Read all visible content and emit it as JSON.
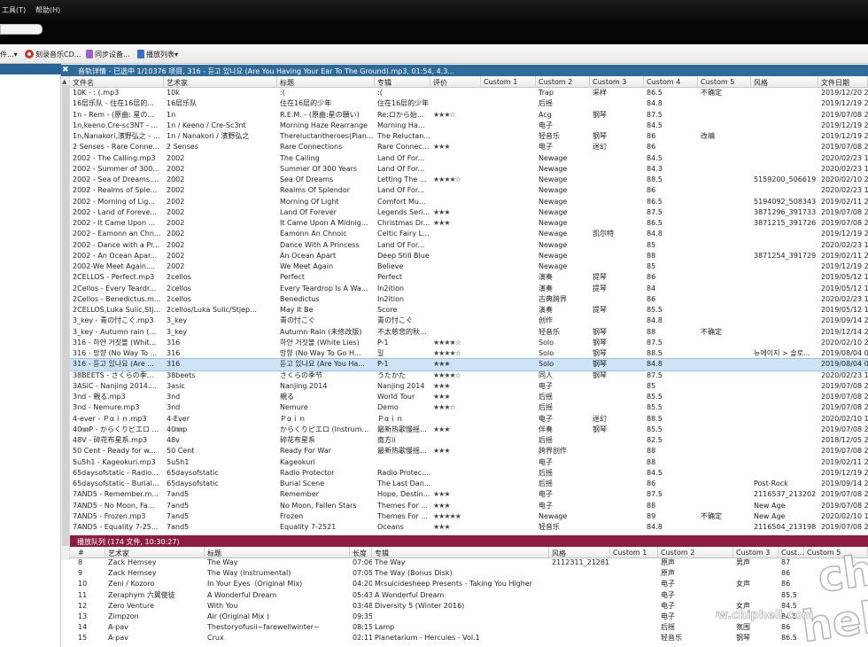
{
  "menu": {
    "tools": "工具(T)",
    "help": "帮助(H)"
  },
  "toolbar": {
    "items": [
      {
        "label": "件..."
      },
      {
        "label": "刻录音乐CD..."
      },
      {
        "label": "同步设备..."
      },
      {
        "label": "播放列表"
      }
    ],
    "dropdown_arrow": "▾",
    "colors": {
      "burn": "#c0392b",
      "sync": "#a061c2",
      "playlist": "#3a6fc4"
    }
  },
  "track_panel": {
    "close_glyph": "✖",
    "title": "音轨详情 - 已选中 1/10376 项目, 316 - 듣고 있나요 (Are You Having Your Ear To The Ground).mp3, 01:54, 4.3..."
  },
  "columns": [
    "文件名",
    "艺术家",
    "标题",
    "专辑",
    "评价",
    "Custom 1",
    "Custom 2",
    "Custom 3",
    "Custom 4",
    "Custom 5",
    "风格",
    "文件日期"
  ],
  "sort_glyph": "▲",
  "rows": [
    {
      "file": "10K - : (.mp3",
      "artist": "10k",
      "title": ":(",
      "album": ":(",
      "rating": "",
      "c1": "",
      "c2": "Trap",
      "c3": "采样",
      "c4": "86.5",
      "c5": "不确定",
      "genre": "",
      "date": "2019/12/20 2",
      "sel": false
    },
    {
      "file": "16层乐队 - 住在16层的...",
      "artist": "16层乐队",
      "title": "住在16层的少年",
      "album": "住在16层的少年",
      "rating": "",
      "c1": "",
      "c2": "后摇",
      "c3": "",
      "c4": "84.8",
      "c5": "",
      "genre": "",
      "date": "2019/12/19 2",
      "sel": false
    },
    {
      "file": "1n - Rem - (原曲: 星の...",
      "artist": "1n",
      "title": "R.E.M. - (原曲:星の願い)",
      "album": "Re:ロから始...",
      "rating": "★★★☆",
      "c1": "",
      "c2": "Acg",
      "c3": "钢琴",
      "c4": "87.5",
      "c5": "",
      "genre": "",
      "date": "2019/07/08 2",
      "sel": false
    },
    {
      "file": "1n,keeno,Cre-sc3NT - ...",
      "artist": "1n / Keeno / Cre-Sc3nt",
      "title": "Morning Haze Rearrange",
      "album": "Morning Ha...",
      "rating": "",
      "c1": "",
      "c2": "电子",
      "c3": "",
      "c4": "84.5",
      "c5": "",
      "genre": "",
      "date": "2019/12/19 2",
      "sel": false
    },
    {
      "file": "1n,Nanakori,濱野弘之 - ...",
      "artist": "1n / Nanakori / 濱野弘之",
      "title": "Thereluctantheroes(Pian...",
      "album": "The Reluctan...",
      "rating": "",
      "c1": "",
      "c2": "轻音乐",
      "c3": "钢琴",
      "c4": "86",
      "c5": "改编",
      "genre": "",
      "date": "2019/12/19 2",
      "sel": false
    },
    {
      "file": "2 Senses - Rare Conne...",
      "artist": "2 Senses",
      "title": "Rare Connections",
      "album": "Rare Connec...",
      "rating": "★★★",
      "c1": "",
      "c2": "电子",
      "c3": "迷幻",
      "c4": "86",
      "c5": "",
      "genre": "",
      "date": "2019/07/08 2",
      "sel": false
    },
    {
      "file": "2002 - The Calling.mp3",
      "artist": "2002",
      "title": "The Calling",
      "album": "Land Of For...",
      "rating": "",
      "c1": "",
      "c2": "Newage",
      "c3": "",
      "c4": "84.5",
      "c5": "",
      "genre": "",
      "date": "2020/02/23 1",
      "sel": false
    },
    {
      "file": "2002 - Summer of 300...",
      "artist": "2002",
      "title": "Summer Of 300 Years",
      "album": "Land Of For...",
      "rating": "",
      "c1": "",
      "c2": "Newage",
      "c3": "",
      "c4": "84.3",
      "c5": "",
      "genre": "",
      "date": "2020/02/23 1",
      "sel": false
    },
    {
      "file": "2002 - Sea of Dreams....",
      "artist": "2002",
      "title": "Sea Of Dreams",
      "album": "Letting The ...",
      "rating": "★★★★☆",
      "c1": "",
      "c2": "Newage",
      "c3": "",
      "c4": "88.5",
      "c5": "",
      "genre": "5159200_506619",
      "date": "2020/02/10 2",
      "sel": false
    },
    {
      "file": "2002 - Realms of Sple...",
      "artist": "2002",
      "title": "Realms Of Splendor",
      "album": "Land Of For...",
      "rating": "",
      "c1": "",
      "c2": "Newage",
      "c3": "",
      "c4": "86",
      "c5": "",
      "genre": "",
      "date": "2020/02/23 1",
      "sel": false
    },
    {
      "file": "2002 - Morning of Lig...",
      "artist": "2002",
      "title": "Morning Of Light",
      "album": "Comfort Mu...",
      "rating": "",
      "c1": "",
      "c2": "Newage",
      "c3": "",
      "c4": "86.5",
      "c5": "",
      "genre": "5194092_508343",
      "date": "2019/02/11 2",
      "sel": false
    },
    {
      "file": "2002 - Land of Foreve...",
      "artist": "2002",
      "title": "Land Of Forever",
      "album": "Legends Seri...",
      "rating": "★★★",
      "c1": "",
      "c2": "Newage",
      "c3": "",
      "c4": "87.5",
      "c5": "",
      "genre": "3871296_391733",
      "date": "2019/07/08 2",
      "sel": false
    },
    {
      "file": "2002 - It Came Upon ...",
      "artist": "2002",
      "title": "It Came Upon A Midnig...",
      "album": "Christmas Dr...",
      "rating": "★★★",
      "c1": "",
      "c2": "Newage",
      "c3": "",
      "c4": "86.5",
      "c5": "",
      "genre": "3871215_391726",
      "date": "2019/07/08 2",
      "sel": false
    },
    {
      "file": "2002 - Eamonn an Chn...",
      "artist": "2002",
      "title": "Éamonn An Chnoic",
      "album": "Celtic Fairy L...",
      "rating": "",
      "c1": "",
      "c2": "Newage",
      "c3": "凯尔特",
      "c4": "84.8",
      "c5": "",
      "genre": "",
      "date": "2019/12/19 2",
      "sel": false
    },
    {
      "file": "2002 - Dance with a Pr...",
      "artist": "2002",
      "title": "Dance With A Princess",
      "album": "Land Of For...",
      "rating": "",
      "c1": "",
      "c2": "Newage",
      "c3": "",
      "c4": "85",
      "c5": "",
      "genre": "",
      "date": "2020/02/23 1",
      "sel": false
    },
    {
      "file": "2002 - An Ocean Apar...",
      "artist": "2002",
      "title": "An Ocean Apart",
      "album": "Deep Still Blue",
      "rating": "",
      "c1": "",
      "c2": "Newage",
      "c3": "",
      "c4": "88",
      "c5": "",
      "genre": "3871254_391729",
      "date": "2019/02/11 2",
      "sel": false
    },
    {
      "file": "2002-We Meet Again....",
      "artist": "2002",
      "title": "We Meet Again",
      "album": "Believe",
      "rating": "",
      "c1": "",
      "c2": "Newage",
      "c3": "",
      "c4": "85",
      "c5": "",
      "genre": "",
      "date": "2019/12/19 2",
      "sel": false
    },
    {
      "file": "2CELLOS - Perfect.mp3",
      "artist": "2cellos",
      "title": "Perfect",
      "album": "Perfect",
      "rating": "",
      "c1": "",
      "c2": "演奏",
      "c3": "提琴",
      "c4": "86",
      "c5": "",
      "genre": "",
      "date": "2019/05/12 1",
      "sel": false
    },
    {
      "file": "2Cellos - Every Teardr...",
      "artist": "2cellos",
      "title": "Every Teardrop Is A Wa...",
      "album": "In2ition",
      "rating": "",
      "c1": "",
      "c2": "演奏",
      "c3": "提琴",
      "c4": "84",
      "c5": "",
      "genre": "",
      "date": "2019/05/12 1",
      "sel": false
    },
    {
      "file": "2Cellos - Benedictus.m...",
      "artist": "2cellos",
      "title": "Benedictus",
      "album": "In2ition",
      "rating": "",
      "c1": "",
      "c2": "古典跨界",
      "c3": "",
      "c4": "86",
      "c5": "",
      "genre": "",
      "date": "2020/02/23 1",
      "sel": false
    },
    {
      "file": "2CELLOS,Luka Sulic,Stj...",
      "artist": "2cellos/Luka Sulic/Stjep...",
      "title": "May It Be",
      "album": "Score",
      "rating": "",
      "c1": "",
      "c2": "演奏",
      "c3": "提琴",
      "c4": "85.5",
      "c5": "",
      "genre": "",
      "date": "2019/05/12 1",
      "sel": false
    },
    {
      "file": "3_key - 青の忖こぐ.mp3",
      "artist": "3_key",
      "title": "青の忖こぐ",
      "album": "青の忖こぐ",
      "rating": "",
      "c1": "",
      "c2": "创作",
      "c3": "",
      "c4": "84.8",
      "c5": "",
      "genre": "",
      "date": "2019/09/14 2",
      "sel": false
    },
    {
      "file": "3_key - Autumn rain (...",
      "artist": "3_key",
      "title": "Autumn Rain (未修改版)",
      "album": "不太慈悲的秋...",
      "rating": "",
      "c1": "",
      "c2": "轻音乐",
      "c3": "钢琴",
      "c4": "88",
      "c5": "不确定",
      "genre": "",
      "date": "2019/12/14 2",
      "sel": false
    },
    {
      "file": "316 - 하얀 거짓볼 (Whit...",
      "artist": "316",
      "title": "하얀 거짓볼 (White Lies)",
      "album": "P-1",
      "rating": "★★★★☆",
      "c1": "",
      "c2": "Solo",
      "c3": "钢琴",
      "c4": "87.5",
      "c5": "",
      "genre": "",
      "date": "2020/02/10 2",
      "sel": false
    },
    {
      "file": "316 - 망향 (No Way To ...",
      "artist": "316",
      "title": "망향 (No Way To Go H...",
      "album": "밀",
      "rating": "★★★★☆",
      "c1": "",
      "c2": "Solo",
      "c3": "钢琴",
      "c4": "88.5",
      "c5": "",
      "genre": "뉴에이지 > 솔로...",
      "date": "2019/08/04 0",
      "sel": false
    },
    {
      "file": "316 - 듣고 있나요 (Are ...",
      "artist": "316",
      "title": "듣고 있나요 (Are You Ha...",
      "album": "P-1",
      "rating": "★★★",
      "c1": "",
      "c2": "Solo",
      "c3": "钢琴",
      "c4": "84.8",
      "c5": "",
      "genre": "",
      "date": "2019/08/04 0",
      "sel": true
    },
    {
      "file": "38BEETS - さくらの季...",
      "artist": "38beets",
      "title": "さくらの季节",
      "album": "うたかた",
      "rating": "★★★★☆",
      "c1": "",
      "c2": "同人",
      "c3": "钢琴",
      "c4": "87.5",
      "c5": "",
      "genre": "",
      "date": "2020/02/23 1",
      "sel": false
    },
    {
      "file": "3ASiC - Nanjing 2014....",
      "artist": "3asic",
      "title": "Nanjing 2014",
      "album": "Nanjing 2014",
      "rating": "★★★",
      "c1": "",
      "c2": "电子",
      "c3": "",
      "c4": "85",
      "c5": "",
      "genre": "",
      "date": "2019/07/08 2",
      "sel": false
    },
    {
      "file": "3nd - 親る.mp3",
      "artist": "3nd",
      "title": "親る",
      "album": "World Tour",
      "rating": "★★★",
      "c1": "",
      "c2": "后摇",
      "c3": "",
      "c4": "85.5",
      "c5": "",
      "genre": "",
      "date": "2019/07/08 2",
      "sel": false
    },
    {
      "file": "3nd - Nemure.mp3",
      "artist": "3nd",
      "title": "Nemure",
      "album": "Demo",
      "rating": "★★★☆",
      "c1": "",
      "c2": "后摇",
      "c3": "",
      "c4": "85.5",
      "c5": "",
      "genre": "",
      "date": "2019/07/08 2",
      "sel": false
    },
    {
      "file": "4-ever - Ｐαｉｎ.mp3",
      "artist": "4-Ever",
      "title": "Ｐαｉｎ",
      "album": "Ｐαｉｎ",
      "rating": "",
      "c1": "",
      "c2": "电子",
      "c3": "迷幻",
      "c4": "88.5",
      "c5": "",
      "genre": "",
      "date": "2020/02/10 1",
      "sel": false
    },
    {
      "file": "40㎜P - からくりピエロ ...",
      "artist": "40㎜p",
      "title": "からくりピエロ (Instrum...",
      "album": "最新热歌慢摇...",
      "rating": "★★★",
      "c1": "",
      "c2": "伴奏",
      "c3": "钢琴",
      "c4": "85.5",
      "c5": "",
      "genre": "",
      "date": "2019/07/08 2",
      "sel": false
    },
    {
      "file": "48V - 碎花布星系.mp3",
      "artist": "48v",
      "title": "碎花布星系",
      "album": "南方ii",
      "rating": "",
      "c1": "",
      "c2": "后摇",
      "c3": "",
      "c4": "82.5",
      "c5": "",
      "genre": "",
      "date": "2018/12/05 2",
      "sel": false
    },
    {
      "file": "50 Cent - Ready for w...",
      "artist": "50 Cent",
      "title": "Ready For War",
      "album": "最新热歌慢摇...",
      "rating": "★★★",
      "c1": "",
      "c2": "跨界创作",
      "c3": "",
      "c4": "88",
      "c5": "",
      "genre": "",
      "date": "2019/07/08 2",
      "sel": false
    },
    {
      "file": "5u5h1 - Kageokuri.mp3",
      "artist": "5u5h1",
      "title": "Kageokuri",
      "album": "",
      "rating": "",
      "c1": "",
      "c2": "电子",
      "c3": "",
      "c4": "88",
      "c5": "",
      "genre": "",
      "date": "2019/02/11 2",
      "sel": false
    },
    {
      "file": "65daysofstatic - Radio...",
      "artist": "65daysofstatic",
      "title": "Radio Protector",
      "album": "Radio Protec...",
      "rating": "",
      "c1": "",
      "c2": "后摇",
      "c3": "",
      "c4": "84.5",
      "c5": "",
      "genre": "",
      "date": "2019/12/19 2",
      "sel": false
    },
    {
      "file": "65daysofstatic - Burial...",
      "artist": "65daysofstatic",
      "title": "Burial Scene",
      "album": "The Last Dan...",
      "rating": "",
      "c1": "",
      "c2": "后摇",
      "c3": "",
      "c4": "86",
      "c5": "",
      "genre": "Post-Rock",
      "date": "2019/09/14 2",
      "sel": false
    },
    {
      "file": "7AND5 - Remember.m...",
      "artist": "7and5",
      "title": "Remember",
      "album": "Hope, Destin...",
      "rating": "★★★",
      "c1": "",
      "c2": "电子",
      "c3": "",
      "c4": "87.5",
      "c5": "",
      "genre": "2116537_213202",
      "date": "2019/07/08 2",
      "sel": false
    },
    {
      "file": "7AND5 - No Moon, Fa...",
      "artist": "7and5",
      "title": "No Moon, Fallen Stars",
      "album": "Themes For ...",
      "rating": "★★★",
      "c1": "",
      "c2": "电子",
      "c3": "",
      "c4": "88",
      "c5": "",
      "genre": "New Age",
      "date": "2019/07/08 2",
      "sel": false
    },
    {
      "file": "7AND5 - Frozen.mp3",
      "artist": "7and5",
      "title": "Frozen",
      "album": "Themes For ...",
      "rating": "★★★★★",
      "c1": "",
      "c2": "Newage",
      "c3": "",
      "c4": "89",
      "c5": "不确定",
      "genre": "New Age",
      "date": "2020/02/10 1",
      "sel": false
    },
    {
      "file": "7AND5 - Equality 7-25...",
      "artist": "7and5",
      "title": "Equality 7-2521",
      "album": "Oceans",
      "rating": "★★★",
      "c1": "",
      "c2": "轻音乐",
      "c3": "",
      "c4": "84.8",
      "c5": "",
      "genre": "2116504_213198",
      "date": "2019/07/08 2",
      "sel": false
    }
  ],
  "queue": {
    "title": "播放队列 (174 文件, 10:30:27)",
    "columns": [
      "#",
      "艺术家",
      "标题",
      "长度",
      "专辑",
      "风格",
      "Custom 1",
      "Custom 2",
      "Custom 3",
      "Cust...",
      "Custom 5"
    ],
    "rows": [
      {
        "n": "8",
        "artist": "Zack Hemsey",
        "title": "The Way",
        "len": "07:06",
        "album": "The Way",
        "genre": "2112311_212812",
        "c1": "",
        "c2": "原声",
        "c3": "男声",
        "c4": "87"
      },
      {
        "n": "9",
        "artist": "Zack Hemsey",
        "title": "The Way (Instrumental)",
        "len": "07:05",
        "album": "The Way (Bonus Disk)",
        "genre": "",
        "c1": "",
        "c2": "原声",
        "c3": "",
        "c4": "86"
      },
      {
        "n": "10",
        "artist": "Zeni / Kozoro",
        "title": "In Your Eyes（Original Mix)",
        "len": "04:20",
        "album": "Mrsuicidesheep Presents - Taking You Higher",
        "genre": "",
        "c1": "",
        "c2": "电子",
        "c3": "女声",
        "c4": "86"
      },
      {
        "n": "11",
        "artist": "Zeraphym 六翼使徒",
        "title": "A Wonderful Dream",
        "len": "05:43",
        "album": "A Wonderful Dream",
        "genre": "",
        "c1": "",
        "c2": "电子",
        "c3": "",
        "c4": "85.5"
      },
      {
        "n": "12",
        "artist": "Zero Venture",
        "title": "With You",
        "len": "03:48",
        "album": "Diversity 5 (Winter 2016)",
        "genre": "",
        "c1": "",
        "c2": "电子",
        "c3": "女声",
        "c4": "84.5"
      },
      {
        "n": "13",
        "artist": "Zimpzon",
        "title": "Air (Original Mix )",
        "len": "09:35",
        "album": "",
        "genre": "",
        "c1": "",
        "c2": "电子",
        "c3": "",
        "c4": "84.5"
      },
      {
        "n": "14",
        "artist": "A-pav",
        "title": "Thestoryofusii~farewellwinter~",
        "len": "08:15",
        "album": "Lamp",
        "genre": "",
        "c1": "",
        "c2": "后摇",
        "c3": "氛围",
        "c4": "86"
      },
      {
        "n": "15",
        "artist": "A-pav",
        "title": "Crux",
        "len": "02:11",
        "album": "Planetarium - Hercules - Vol.1",
        "genre": "",
        "c1": "",
        "c2": "轻音乐",
        "c3": "钢琴",
        "c4": "86.5"
      }
    ]
  },
  "watermark": {
    "logo": "chip hell",
    "url": "www.chiphell.com"
  }
}
